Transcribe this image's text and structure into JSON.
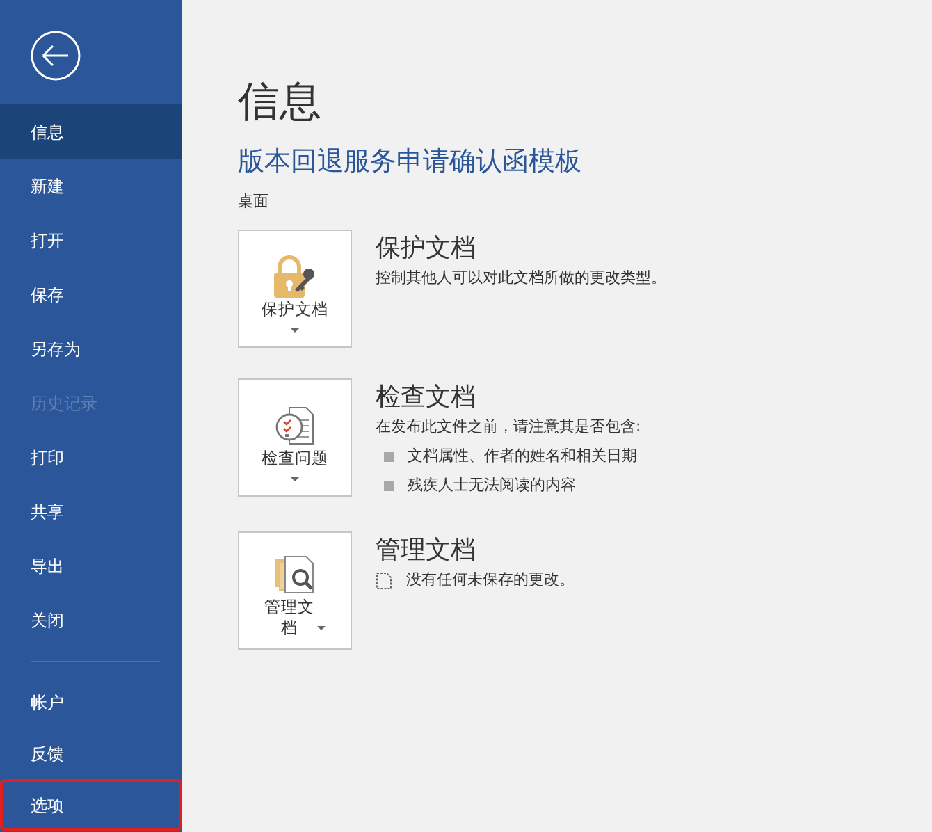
{
  "sidebar": {
    "items": [
      {
        "label": "信息",
        "selected": true,
        "disabled": false,
        "highlighted": false
      },
      {
        "label": "新建",
        "selected": false,
        "disabled": false,
        "highlighted": false
      },
      {
        "label": "打开",
        "selected": false,
        "disabled": false,
        "highlighted": false
      },
      {
        "label": "保存",
        "selected": false,
        "disabled": false,
        "highlighted": false
      },
      {
        "label": "另存为",
        "selected": false,
        "disabled": false,
        "highlighted": false
      },
      {
        "label": "历史记录",
        "selected": false,
        "disabled": true,
        "highlighted": false
      },
      {
        "label": "打印",
        "selected": false,
        "disabled": false,
        "highlighted": false
      },
      {
        "label": "共享",
        "selected": false,
        "disabled": false,
        "highlighted": false
      },
      {
        "label": "导出",
        "selected": false,
        "disabled": false,
        "highlighted": false
      },
      {
        "label": "关闭",
        "selected": false,
        "disabled": false,
        "highlighted": false
      }
    ],
    "bottom_items": [
      {
        "label": "帐户",
        "selected": false,
        "disabled": false,
        "highlighted": false
      },
      {
        "label": "反馈",
        "selected": false,
        "disabled": false,
        "highlighted": false
      },
      {
        "label": "选项",
        "selected": false,
        "disabled": false,
        "highlighted": true
      }
    ]
  },
  "page_title": "信息",
  "document_title": "版本回退服务申请确认函模板",
  "location": "桌面",
  "sections": [
    {
      "kind": "protect",
      "button_label": "保护文档",
      "caret_inline": false,
      "heading": "保护文档",
      "details": [
        {
          "kind": "text",
          "text": "控制其他人可以对此文档所做的更改类型。"
        }
      ]
    },
    {
      "kind": "inspect",
      "button_label": "检查问题",
      "caret_inline": false,
      "heading": "检查文档",
      "details": [
        {
          "kind": "text",
          "text": "在发布此文件之前，请注意其是否包含:"
        },
        {
          "kind": "bullet",
          "text": "文档属性、作者的姓名和相关日期"
        },
        {
          "kind": "bullet",
          "text": "残疾人士无法阅读的内容"
        }
      ]
    },
    {
      "kind": "manage",
      "button_label": "管理文档",
      "caret_inline": true,
      "heading": "管理文档",
      "details": [
        {
          "kind": "note",
          "text": "没有任何未保存的更改。"
        }
      ]
    }
  ]
}
